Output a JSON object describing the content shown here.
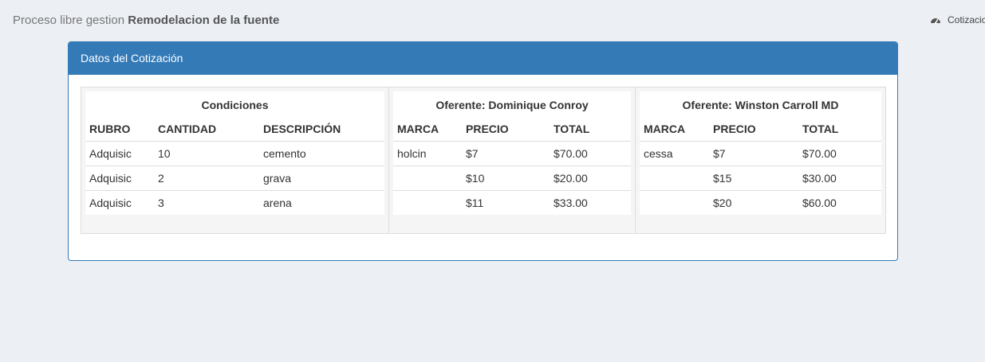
{
  "header": {
    "prefix": "Proceso libre gestion",
    "project": "Remodelacion de la fuente"
  },
  "breadcrumb": {
    "icon": "dashboard-icon",
    "label": "Cotizacio"
  },
  "panel": {
    "title": "Datos del Cotización"
  },
  "conditions": {
    "caption": "Condiciones",
    "headers": [
      "RUBRO",
      "CANTIDAD",
      "DESCRIPCIÓN"
    ],
    "rows": [
      [
        "Adquisic",
        "10",
        "cemento"
      ],
      [
        "Adquisic",
        "2",
        "grava"
      ],
      [
        "Adquisic",
        "3",
        "arena"
      ]
    ]
  },
  "offers": [
    {
      "caption": "Oferente: Dominique Conroy",
      "headers": [
        "MARCA",
        "PRECIO",
        "TOTAL"
      ],
      "rows": [
        [
          "holcin",
          "$7",
          "$70.00"
        ],
        [
          "",
          "$10",
          "$20.00"
        ],
        [
          "",
          "$11",
          "$33.00"
        ]
      ]
    },
    {
      "caption": "Oferente: Winston Carroll MD",
      "headers": [
        "MARCA",
        "PRECIO",
        "TOTAL"
      ],
      "rows": [
        [
          "cessa",
          "$7",
          "$70.00"
        ],
        [
          "",
          "$15",
          "$30.00"
        ],
        [
          "",
          "$20",
          "$60.00"
        ]
      ]
    }
  ],
  "colors": {
    "primary": "#337ab7",
    "background": "#ecf0f5"
  }
}
